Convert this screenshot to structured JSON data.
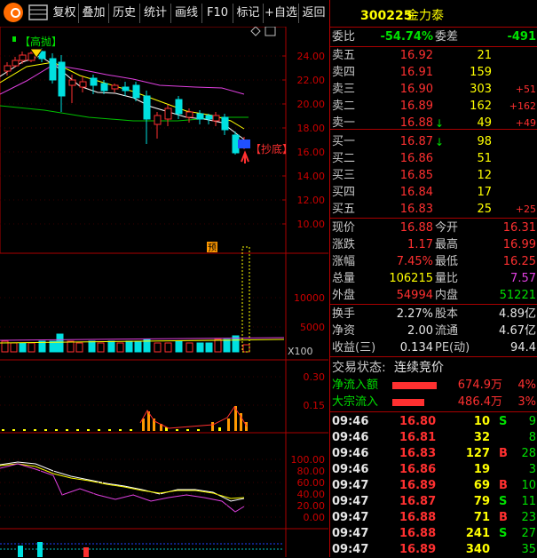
{
  "toolbar": {
    "buttons": [
      "复权",
      "叠加",
      "历史",
      "统计",
      "画线",
      "F10",
      "标记",
      "+自选",
      "返回"
    ]
  },
  "stock": {
    "code": "300225",
    "name": "金力泰"
  },
  "chart": {
    "badge_high": "【高抛】",
    "badge_low": "【抄底】",
    "forecast_badge": "预",
    "price_ticks": [
      "24.00",
      "22.00",
      "20.00",
      "18.00",
      "16.00",
      "14.00",
      "12.00",
      "10.00"
    ],
    "volume_ticks": [
      "10000",
      "5000"
    ],
    "volume_unit": "X100",
    "ind1_ticks": [
      "0.30",
      "0.15"
    ],
    "ind2_ticks": [
      "100.00",
      "80.00",
      "60.00",
      "40.00",
      "20.00",
      "0.00"
    ],
    "colors": {
      "up": "#ff3030",
      "down": "#00e0e0",
      "ma5": "#ffffff",
      "ma10": "#ffff00",
      "ma20": "#e040e0",
      "ma60": "#00c000"
    }
  },
  "quote": {
    "weibi_label": "委比",
    "weibi": "-54.74%",
    "weicha_label": "委差",
    "weicha": "-491",
    "asks": [
      {
        "label": "卖五",
        "price": "16.92",
        "vol": "21",
        "chg": ""
      },
      {
        "label": "卖四",
        "price": "16.91",
        "vol": "159",
        "chg": ""
      },
      {
        "label": "卖三",
        "price": "16.90",
        "vol": "303",
        "chg": "+51"
      },
      {
        "label": "卖二",
        "price": "16.89",
        "vol": "162",
        "chg": "+162"
      },
      {
        "label": "卖一",
        "price": "16.88",
        "vol": "49",
        "chg": "+49"
      }
    ],
    "bids": [
      {
        "label": "买一",
        "price": "16.87",
        "vol": "98",
        "chg": ""
      },
      {
        "label": "买二",
        "price": "16.86",
        "vol": "51",
        "chg": ""
      },
      {
        "label": "买三",
        "price": "16.85",
        "vol": "12",
        "chg": ""
      },
      {
        "label": "买四",
        "price": "16.84",
        "vol": "17",
        "chg": ""
      },
      {
        "label": "买五",
        "price": "16.83",
        "vol": "25",
        "chg": "+25"
      }
    ],
    "stats": [
      {
        "l1": "现价",
        "v1": "16.88",
        "c1": "red",
        "l2": "今开",
        "v2": "16.31",
        "c2": "red"
      },
      {
        "l1": "涨跌",
        "v1": "1.17",
        "c1": "red",
        "l2": "最高",
        "v2": "16.99",
        "c2": "red"
      },
      {
        "l1": "涨幅",
        "v1": "7.45%",
        "c1": "red",
        "l2": "最低",
        "v2": "16.25",
        "c2": "red"
      },
      {
        "l1": "总量",
        "v1": "106215",
        "c1": "yel",
        "l2": "量比",
        "v2": "7.57",
        "c2": "mag"
      },
      {
        "l1": "外盘",
        "v1": "54994",
        "c1": "red",
        "l2": "内盘",
        "v2": "51221",
        "c2": "grn"
      }
    ],
    "fund": [
      {
        "l1": "换手",
        "v1": "2.27%",
        "l2": "股本",
        "v2": "4.89亿"
      },
      {
        "l1": "净资",
        "v1": "2.00",
        "l2": "流通",
        "v2": "4.67亿"
      },
      {
        "l1": "收益(三)",
        "v1": "0.134",
        "l2": "PE(动)",
        "v2": "94.4"
      }
    ],
    "trade_status_label": "交易状态:",
    "trade_status": "连续竞价",
    "flows": [
      {
        "label": "净流入额",
        "value": "674.9万",
        "pct": "4%",
        "ratio": 0.9
      },
      {
        "label": "大宗流入",
        "value": "486.4万",
        "pct": "3%",
        "ratio": 0.65
      }
    ],
    "ticks": [
      {
        "time": "09:46",
        "price": "16.80",
        "vol": "10",
        "bs": "S",
        "n": "9"
      },
      {
        "time": "09:46",
        "price": "16.81",
        "vol": "32",
        "bs": "",
        "n": "8"
      },
      {
        "time": "09:46",
        "price": "16.83",
        "vol": "127",
        "bs": "B",
        "n": "28"
      },
      {
        "time": "09:46",
        "price": "16.86",
        "vol": "19",
        "bs": "",
        "n": "3"
      },
      {
        "time": "09:47",
        "price": "16.89",
        "vol": "69",
        "bs": "B",
        "n": "10"
      },
      {
        "time": "09:47",
        "price": "16.87",
        "vol": "79",
        "bs": "S",
        "n": "11"
      },
      {
        "time": "09:47",
        "price": "16.88",
        "vol": "71",
        "bs": "B",
        "n": "23"
      },
      {
        "time": "09:47",
        "price": "16.88",
        "vol": "241",
        "bs": "S",
        "n": "27"
      },
      {
        "time": "09:47",
        "price": "16.89",
        "vol": "340",
        "bs": "",
        "n": "35"
      }
    ]
  }
}
